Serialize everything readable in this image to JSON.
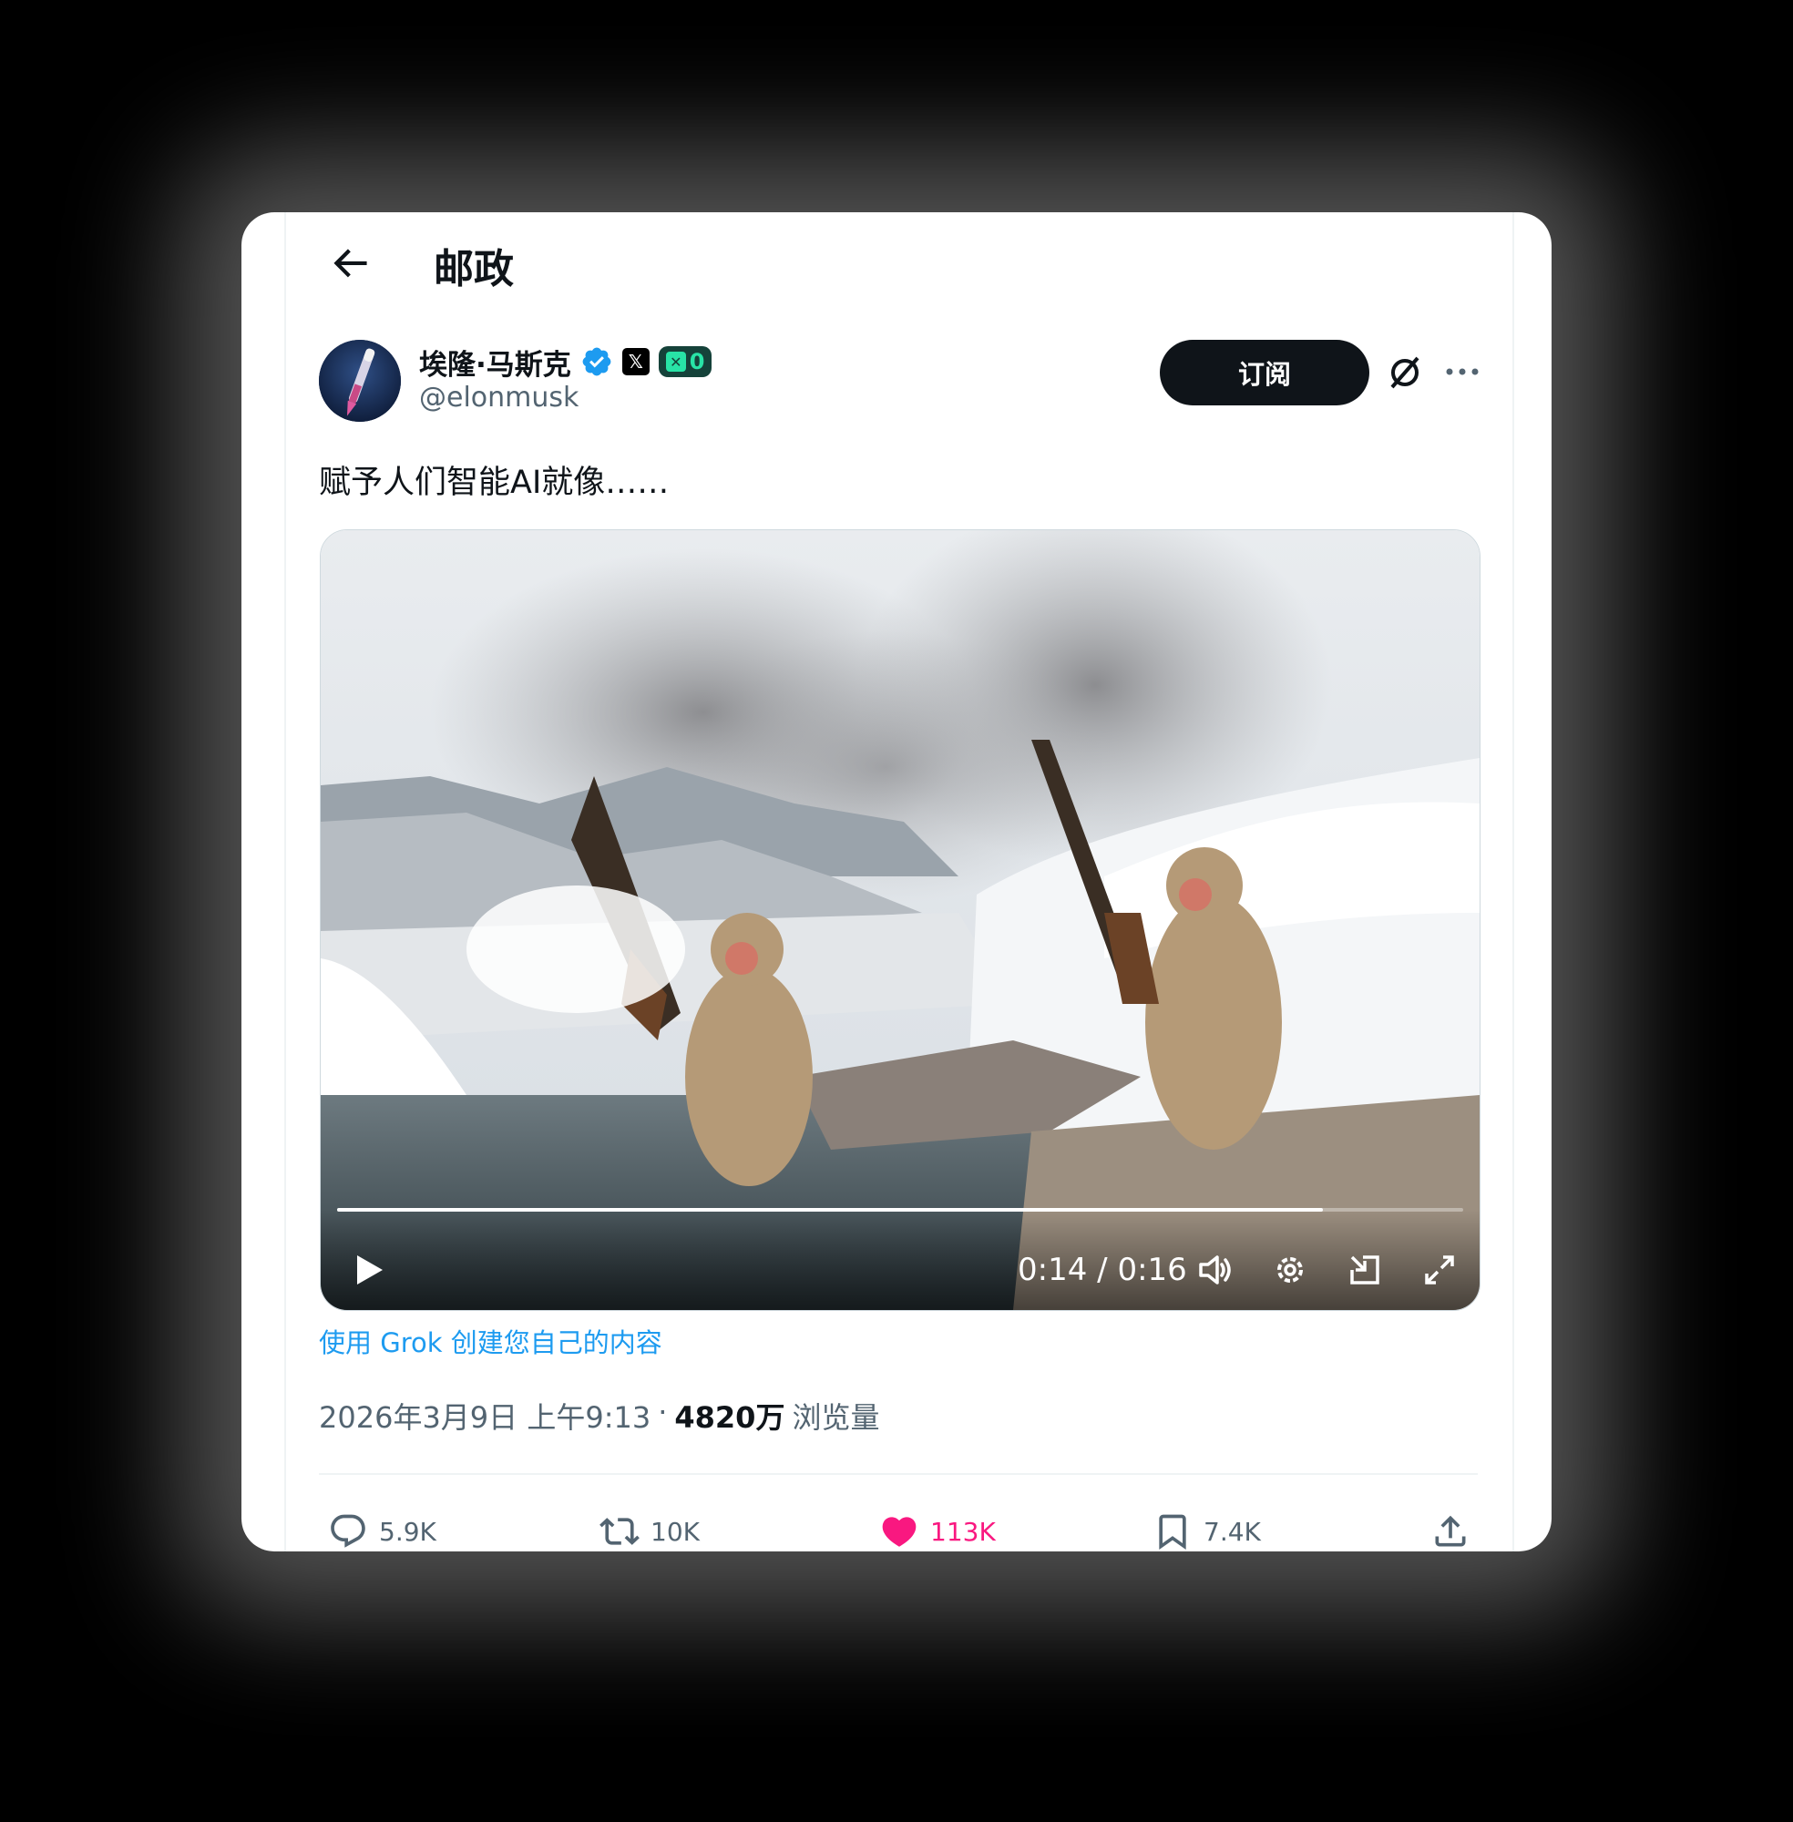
{
  "header": {
    "title": "邮政",
    "back_icon": "arrow-left-icon"
  },
  "author": {
    "name": "埃隆·马斯克",
    "handle": "@elonmusk",
    "verified_icon": "verified-check-icon",
    "x_badge": "𝕏",
    "counter_badge_value": "0"
  },
  "actions_top": {
    "subscribe_label": "订阅",
    "grok_icon": "grok-icon",
    "more_icon": "more-dots-icon"
  },
  "tweet": {
    "text": "赋予人们智能AI就像……"
  },
  "video": {
    "current_time": "0:14",
    "separator": " / ",
    "duration": "0:16",
    "progress": 0.875
  },
  "grok_link": "使用 Grok 创建您自己的内容",
  "meta": {
    "date": "2026年3月9日 上午9:13",
    "dot": "·",
    "views_count": "4820万",
    "views_label": "浏览量"
  },
  "stats": {
    "replies": "5.9K",
    "reposts": "10K",
    "likes": "113K",
    "bookmarks": "7.4K"
  },
  "colors": {
    "accent": "#1d9bf0",
    "like": "#f91880",
    "text": "#0f1419",
    "muted": "#536471"
  }
}
